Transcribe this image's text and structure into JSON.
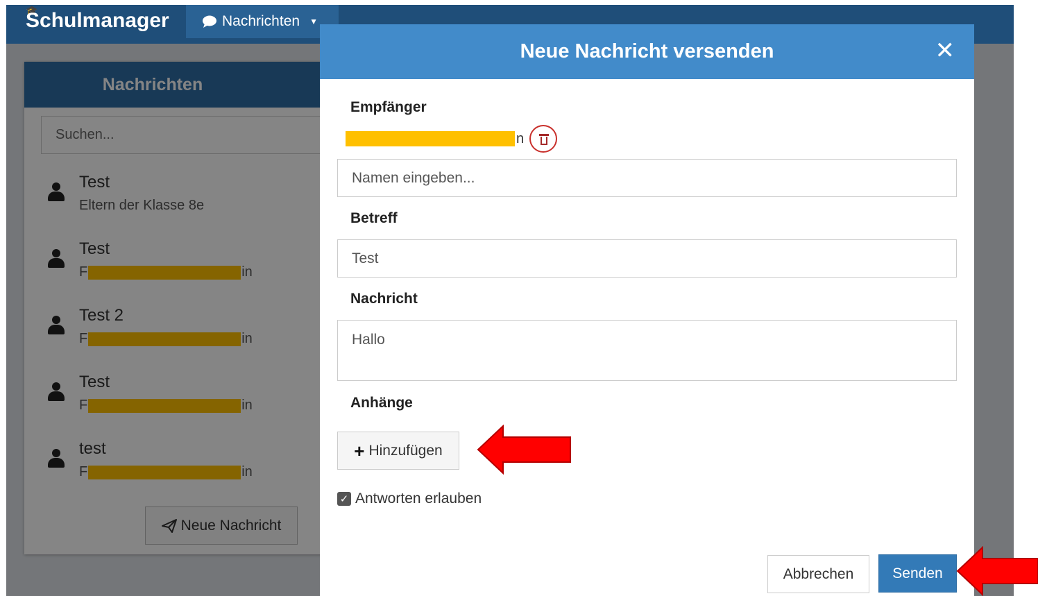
{
  "app": {
    "brand": "Schulmanager",
    "nav_tab": "Nachrichten"
  },
  "sidebar": {
    "title": "Nachrichten",
    "search_placeholder": "Suchen...",
    "messages": [
      {
        "title": "Test",
        "sub_prefix": "Eltern der Klasse 8e",
        "sub_suffix": ""
      },
      {
        "title": "Test",
        "sub_prefix": "F",
        "sub_suffix": "in"
      },
      {
        "title": "Test 2",
        "sub_prefix": "F",
        "sub_suffix": "in"
      },
      {
        "title": "Test",
        "sub_prefix": "F",
        "sub_suffix": "in"
      },
      {
        "title": "test",
        "sub_prefix": "F",
        "sub_suffix": "in"
      }
    ],
    "new_message_label": "Neue Nachricht"
  },
  "modal": {
    "title": "Neue Nachricht versenden",
    "close": "✕",
    "recipients_label": "Empfänger",
    "recipient_suffix": "n",
    "name_placeholder": "Namen eingeben...",
    "subject_label": "Betreff",
    "subject_value": "Test",
    "message_label": "Nachricht",
    "message_value": "Hallo",
    "attachments_label": "Anhänge",
    "add_label": "Hinzufügen",
    "allow_replies_label": "Antworten erlauben",
    "allow_replies_checked": true,
    "cancel_label": "Abbrechen",
    "send_label": "Senden"
  },
  "colors": {
    "navbar": "#1f4e79",
    "modal_header": "#428bca",
    "primary_button": "#337ab7",
    "redaction": "#ffc000",
    "annotation_arrow": "#ff0000"
  }
}
